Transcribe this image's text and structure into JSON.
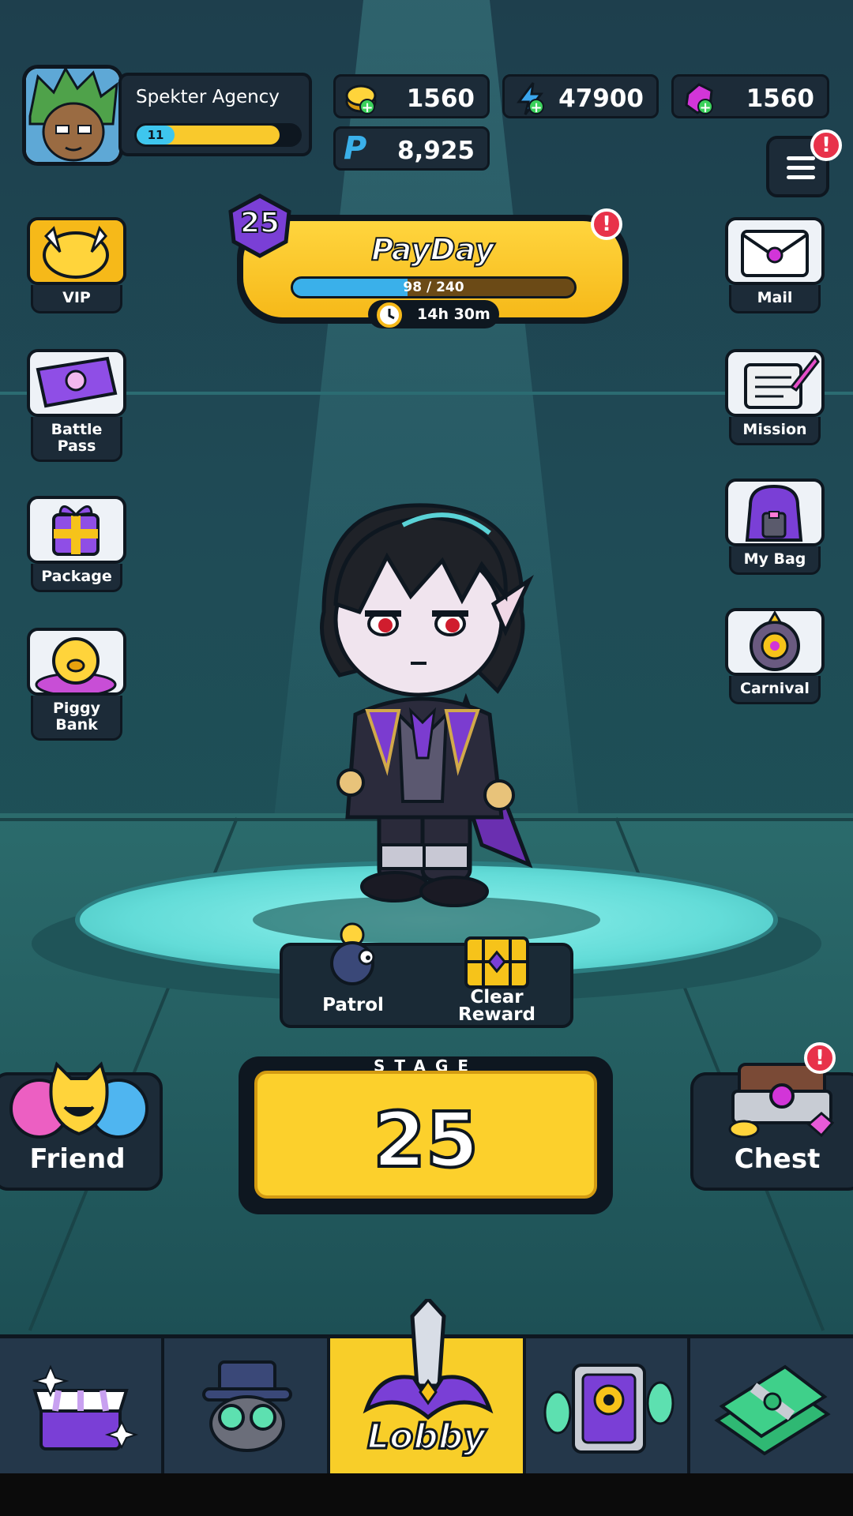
{
  "profile": {
    "name": "Spekter Agency",
    "level": "11",
    "xp_fraction": 0.88
  },
  "currencies": {
    "coins": "1560",
    "energy": "47900",
    "gems": "1560",
    "points": "8,925",
    "points_symbol": "P"
  },
  "payday": {
    "title": "PayDay",
    "level": "25",
    "progress_text": "98 / 240",
    "progress_value": 98,
    "progress_max": 240,
    "timer": "14h 30m"
  },
  "left_menu": [
    {
      "label": "VIP",
      "icon": "vip-coin-icon"
    },
    {
      "label": "Battle Pass",
      "icon": "ticket-icon"
    },
    {
      "label": "Package",
      "icon": "gift-box-icon"
    },
    {
      "label": "Piggy Bank",
      "icon": "piggy-bank-icon"
    }
  ],
  "right_menu": [
    {
      "label": "Mail",
      "icon": "mail-envelope-icon"
    },
    {
      "label": "Mission",
      "icon": "scroll-quill-icon"
    },
    {
      "label": "My Bag",
      "icon": "backpack-icon"
    },
    {
      "label": "Carnival",
      "icon": "prize-wheel-icon"
    }
  ],
  "actions": {
    "patrol": "Patrol",
    "clear_reward": "Clear Reward"
  },
  "stage": {
    "label": "STAGE",
    "number": "25"
  },
  "friend_label": "Friend",
  "chest_label": "Chest",
  "nav": {
    "active_label": "Lobby",
    "items": [
      "shop-icon",
      "agent-icon",
      "lobby-sword-icon",
      "card-portal-icon",
      "cash-icon"
    ]
  },
  "colors": {
    "accent_yellow": "#f8ce29",
    "alert_red": "#e8324a",
    "progress_blue": "#3ab0ea"
  }
}
